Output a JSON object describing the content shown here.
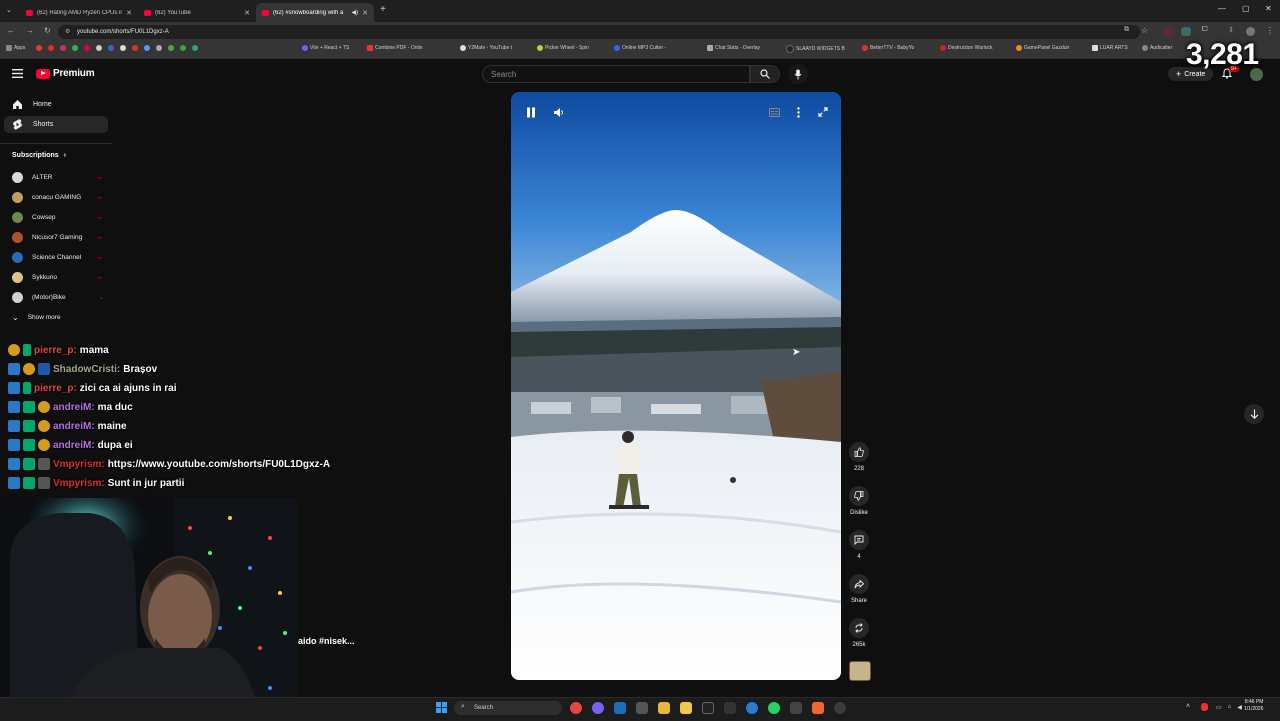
{
  "browser": {
    "tabs": [
      {
        "title": "(62) Rating AMD Ryzen CPUs in"
      },
      {
        "title": "(62) YouTube"
      },
      {
        "title": "(62) #snowboarding with a"
      }
    ],
    "url": "youtube.com/shorts/FU0L1Dgxz-A",
    "bookmarks": [
      "Apps",
      "Vite + React + TS",
      "Combine PDF - Onlin",
      "Y2Mate - YouTube t",
      "Picker Wheel - Spin",
      "Online MP3 Cutter -",
      "Chat Stats - Overlay",
      "SLAAYD WIDGETS B",
      "BetterTTV - BabyYo",
      "Destruction Warlock",
      "GamePanel Gazduir",
      "LUAR ARTS",
      "Audicalter"
    ]
  },
  "youtube": {
    "logo_text": "Premium",
    "search_placeholder": "Search",
    "create_label": "Create",
    "notification_count": "9+"
  },
  "overlay": {
    "counter": "3,281",
    "caption": "aido #nisek..."
  },
  "sidebar": {
    "nav": [
      {
        "label": "Home",
        "icon": "home-icon"
      },
      {
        "label": "Shorts",
        "icon": "shorts-icon"
      }
    ],
    "subscriptions_title": "Subscriptions",
    "subscriptions": [
      {
        "name": "ALTER",
        "color": "#d8d8d8"
      },
      {
        "name": "conacu GAMING",
        "color": "#c0a060"
      },
      {
        "name": "Cowsep",
        "color": "#6a8a4a"
      },
      {
        "name": "Nicusor7 Gaming",
        "color": "#b05030"
      },
      {
        "name": "Science Channel",
        "color": "#2a6ab0"
      },
      {
        "name": "Sykkuno",
        "color": "#e0c090"
      },
      {
        "name": "(Motor)Bike",
        "color": "#d0d0d0"
      }
    ],
    "show_more": "Show more"
  },
  "chat": [
    {
      "user": "pierre_p:",
      "message": "mama",
      "color": "#e04848"
    },
    {
      "user": "ShadowCristi:",
      "message": "Brașov",
      "color": "#a8a890"
    },
    {
      "user": "pierre_p:",
      "message": "zici ca ai ajuns in rai",
      "color": "#e04848"
    },
    {
      "user": "andreiM:",
      "message": "ma duc",
      "color": "#b870e8"
    },
    {
      "user": "andreiM:",
      "message": "maine",
      "color": "#b870e8"
    },
    {
      "user": "andreiM:",
      "message": "dupa ei",
      "color": "#b870e8"
    },
    {
      "user": "Vmpyrism:",
      "message": "https://www.youtube.com/shorts/FU0L1Dgxz-A",
      "color": "#e03030"
    },
    {
      "user": "Vmpyrism:",
      "message": "Sunt in jur partii",
      "color": "#e03030"
    }
  ],
  "actions": [
    {
      "label": "228",
      "icon": "like-icon"
    },
    {
      "label": "Dislike",
      "icon": "dislike-icon"
    },
    {
      "label": "4",
      "icon": "comment-icon"
    },
    {
      "label": "Share",
      "icon": "share-icon"
    },
    {
      "label": "265k",
      "icon": "remix-icon"
    }
  ],
  "taskbar": {
    "search_label": "Search",
    "time": "8:46 PM",
    "date": "1/1/2026"
  }
}
